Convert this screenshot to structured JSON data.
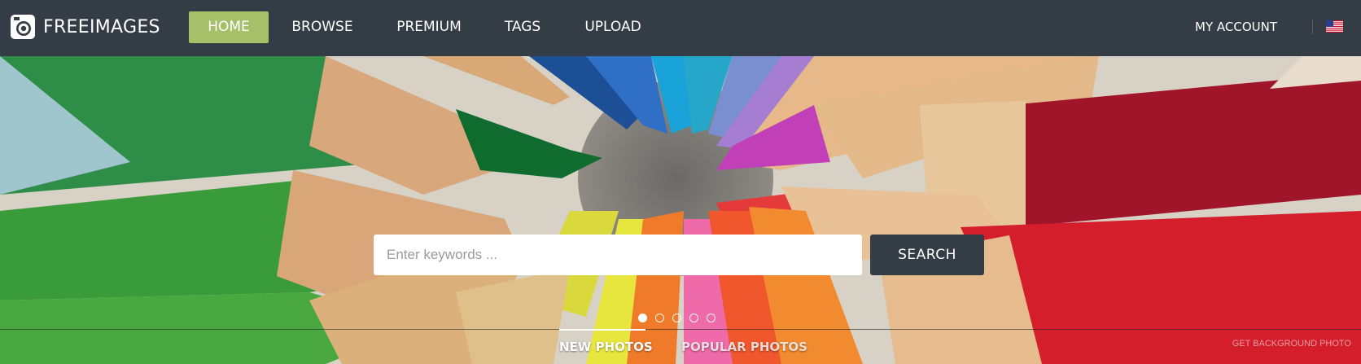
{
  "brand": {
    "name": "FREEIMAGES"
  },
  "nav": {
    "items": [
      {
        "label": "HOME",
        "active": true
      },
      {
        "label": "BROWSE",
        "active": false
      },
      {
        "label": "PREMIUM",
        "active": false
      },
      {
        "label": "TAGS",
        "active": false
      },
      {
        "label": "UPLOAD",
        "active": false
      }
    ],
    "my_account": "MY ACCOUNT",
    "language_flag": "us-flag-icon"
  },
  "search": {
    "placeholder": "Enter keywords ...",
    "value": "",
    "button_label": "SEARCH"
  },
  "carousel": {
    "slides": 5,
    "active_index": 0
  },
  "tabs": [
    {
      "label": "NEW PHOTOS",
      "active": true
    },
    {
      "label": "POPULAR PHOTOS",
      "active": false
    }
  ],
  "footer_credit": "GET BACKGROUND PHOTO",
  "colors": {
    "navbar": "#343d46",
    "active_nav": "#a6c06a",
    "search_button": "#343d46"
  }
}
